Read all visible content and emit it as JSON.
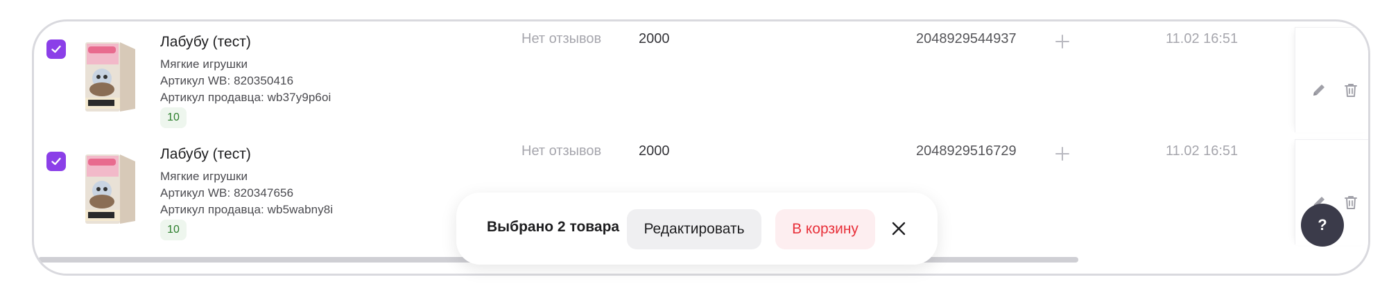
{
  "products": [
    {
      "checked": true,
      "title": "Лабубу (тест)",
      "category": "Мягкие игрушки",
      "article_wb": "Артикул WB: 820350416",
      "seller_article": "Артикул продавца: wb37y9p6oi",
      "stock": "10",
      "reviews": "Нет отзывов",
      "price": "2000",
      "barcode": "2048929544937",
      "date": "11.02 16:51"
    },
    {
      "checked": true,
      "title": "Лабубу (тест)",
      "category": "Мягкие игрушки",
      "article_wb": "Артикул WB: 820347656",
      "seller_article": "Артикул продавца: wb5wabny8i",
      "stock": "10",
      "reviews": "Нет отзывов",
      "price": "2000",
      "barcode": "2048929516729",
      "date": "11.02 16:51"
    }
  ],
  "selection_bar": {
    "text": "Выбрано 2 товара",
    "edit_label": "Редактировать",
    "cart_label": "В корзину"
  },
  "help": {
    "label": "?"
  },
  "icons": {
    "checkbox": "check-icon",
    "plus": "plus-icon",
    "edit": "pencil-icon",
    "delete": "trash-icon",
    "close": "close-icon"
  },
  "colors": {
    "accent": "#8b3fe8",
    "danger": "#e8303a",
    "stock_green": "#2a7d2a",
    "help_bg": "#3b3b4a"
  }
}
